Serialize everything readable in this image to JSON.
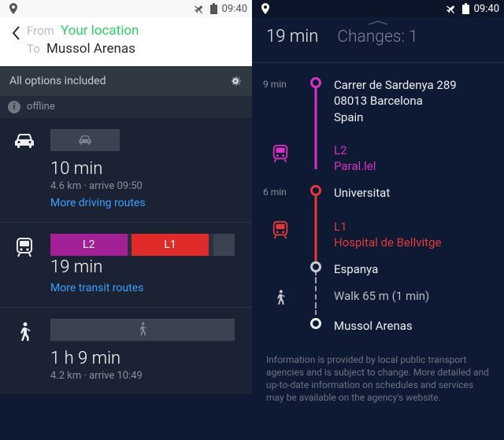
{
  "status": {
    "time": "09:40"
  },
  "left": {
    "from_label": "From",
    "from_value": "Your location",
    "to_label": "To",
    "to_value": "Mussol Arenas",
    "options_label": "All options included",
    "offline_label": "offline",
    "car": {
      "duration": "10 min",
      "sub": "4.6 km · arrive 09:50",
      "link": "More driving routes"
    },
    "transit": {
      "seg1": "L2",
      "seg2": "L1",
      "duration": "19 min",
      "link": "More transit routes"
    },
    "walk": {
      "duration": "1 h 9 min",
      "sub": "4.2 km · arrive 10:49"
    }
  },
  "right": {
    "duration": "19 min",
    "changes_label": "Changes: 1",
    "steps": {
      "s1_time": "9 min",
      "s1_addr1": "Carrer de Sardenya 289",
      "s1_addr2": "08013 Barcelona",
      "s1_addr3": "Spain",
      "s2_line": "L2",
      "s2_dest": "Paral.lel",
      "s3_time": "6 min",
      "s3_name": "Universitat",
      "s4_line": "L1",
      "s4_dest": "Hospital de Bellvitge",
      "s5_name": "Espanya",
      "s6_walk": "Walk 65 m (1 min)",
      "s7_name": "Mussol Arenas"
    },
    "disclaimer": "Information is provided by local public transport agencies and is subject to change. More detailed and up-to-date information on schedules and services may be available on the agency's website."
  }
}
